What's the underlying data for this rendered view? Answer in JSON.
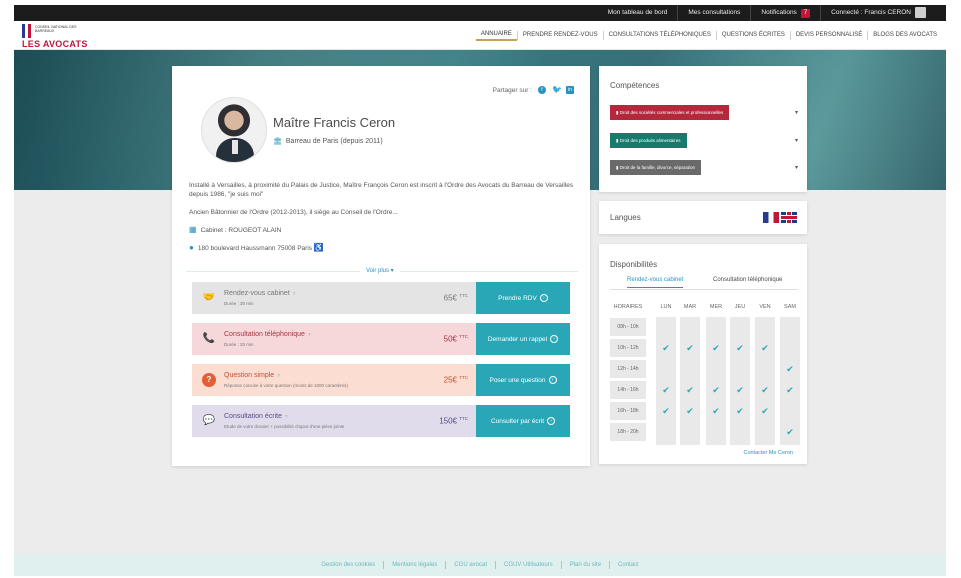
{
  "topbar": {
    "items": [
      "Mon tableau de bord",
      "Mes consultations",
      "Notifications",
      "Connecté : Francis CERON"
    ],
    "notification_count": "7"
  },
  "logo": {
    "small": "CONSEIL NATIONAL DES BARREAUX",
    "big": "LES AVOCATS"
  },
  "nav": {
    "items": [
      "ANNUAIRE",
      "PRENDRE RENDEZ-VOUS",
      "CONSULTATIONS TÉLÉPHONIQUES",
      "QUESTIONS ÉCRITES",
      "DEVIS PERSONNALISÉ",
      "BLOGS DES AVOCATS"
    ]
  },
  "profile": {
    "share_label": "Partager sur :",
    "name": "Maître Francis Ceron",
    "bar": "Barreau de Paris (depuis 2011)",
    "bio1": "Installé à Versailles, à proximité du Palais de Justice, Maître François Ceron est inscrit à l'Ordre des Avocats du Barreau de Versailles depuis 1986, \"je suis moi\"",
    "bio2": "Ancien Bâtonnier de l'Ordre (2012-2013), il siège au Conseil de l'Ordre...",
    "cabinet": "Cabinet : ROUGEOT ALAIN",
    "address": "180 boulevard Haussmann 75008 Paris",
    "voir_plus": "Voir plus ▾"
  },
  "services": [
    {
      "title": "Rendez-vous cabinet",
      "sub": "Durée : 30 min",
      "price": "65€",
      "ttc": "TTC",
      "button": "Prendre RDV"
    },
    {
      "title": "Consultation téléphonique",
      "sub": "Durée : 20 min",
      "price": "50€",
      "ttc": "TTC",
      "button": "Demander un rappel"
    },
    {
      "title": "Question simple",
      "sub": "Réponse concise à votre question (moins de 1000 caractères)",
      "price": "25€",
      "ttc": "TTC",
      "button": "Poser une question"
    },
    {
      "title": "Consultation écrite",
      "sub": "Etude de votre dossier + possibilité d'ajout d'une pièce jointe",
      "price": "150€",
      "ttc": "TTC",
      "button": "Consulter par écrit"
    }
  ],
  "competences": {
    "title": "Compétences",
    "items": [
      {
        "label": "Droit des sociétés commerciales et professionnelles",
        "color": "#b3283b"
      },
      {
        "label": "Droit des produits alimentaires",
        "color": "#177a6d"
      },
      {
        "label": "Droit de la famille, divorce, séparation",
        "color": "#6a6a6a"
      }
    ]
  },
  "langues": {
    "title": "Langues"
  },
  "dispo": {
    "title": "Disponibilités",
    "tabs": [
      "Rendez-vous cabinet",
      "Consultation téléphonique"
    ],
    "headers": [
      "HORAIRES",
      "LUN",
      "MAR",
      "MER",
      "JEU",
      "VEN",
      "SAM"
    ],
    "hours": [
      "08h - 10h",
      "10h - 12h",
      "12h - 14h",
      "14h - 16h",
      "16h - 18h",
      "18h - 20h"
    ],
    "available": [
      [
        false,
        false,
        false,
        false,
        false,
        false
      ],
      [
        true,
        true,
        true,
        true,
        true,
        false
      ],
      [
        false,
        false,
        false,
        false,
        false,
        true
      ],
      [
        true,
        true,
        true,
        true,
        true,
        true
      ],
      [
        true,
        true,
        true,
        true,
        true,
        false
      ],
      [
        false,
        false,
        false,
        false,
        false,
        true
      ]
    ],
    "contact": "Contacter Me Ceron"
  },
  "footer": {
    "items": [
      "Gestion des cookies",
      "Mentions légales",
      "CGU avocat",
      "CGUV Utilisateurs",
      "Plan du site",
      "Contact"
    ]
  }
}
